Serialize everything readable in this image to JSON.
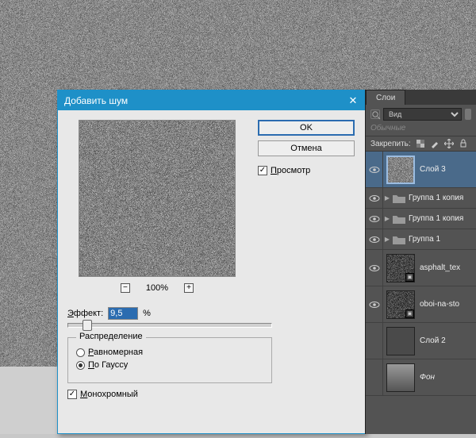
{
  "dialog": {
    "title": "Добавить шум",
    "ok": "OK",
    "cancel": "Отмена",
    "preview_label": "Просмотр",
    "zoom_percent": "100%",
    "effect_label": "Эффект:",
    "effect_value": "9,5",
    "effect_unit": "%",
    "distribution_legend": "Распределение",
    "uniform": "Равномерная",
    "gaussian": "По Гауссу",
    "mono": "Монохромный"
  },
  "layers": {
    "tab": "Слои",
    "search_mode": "Вид",
    "blend": "Обычные",
    "lock_label": "Закрепить:",
    "item_selected": "Слой 3",
    "group_copy": "Группа 1 копия",
    "group": "Группа 1",
    "asphalt": "asphalt_tex",
    "oboi": "oboi-na-sto",
    "layer2": "Слой 2",
    "bg": "Фон"
  }
}
